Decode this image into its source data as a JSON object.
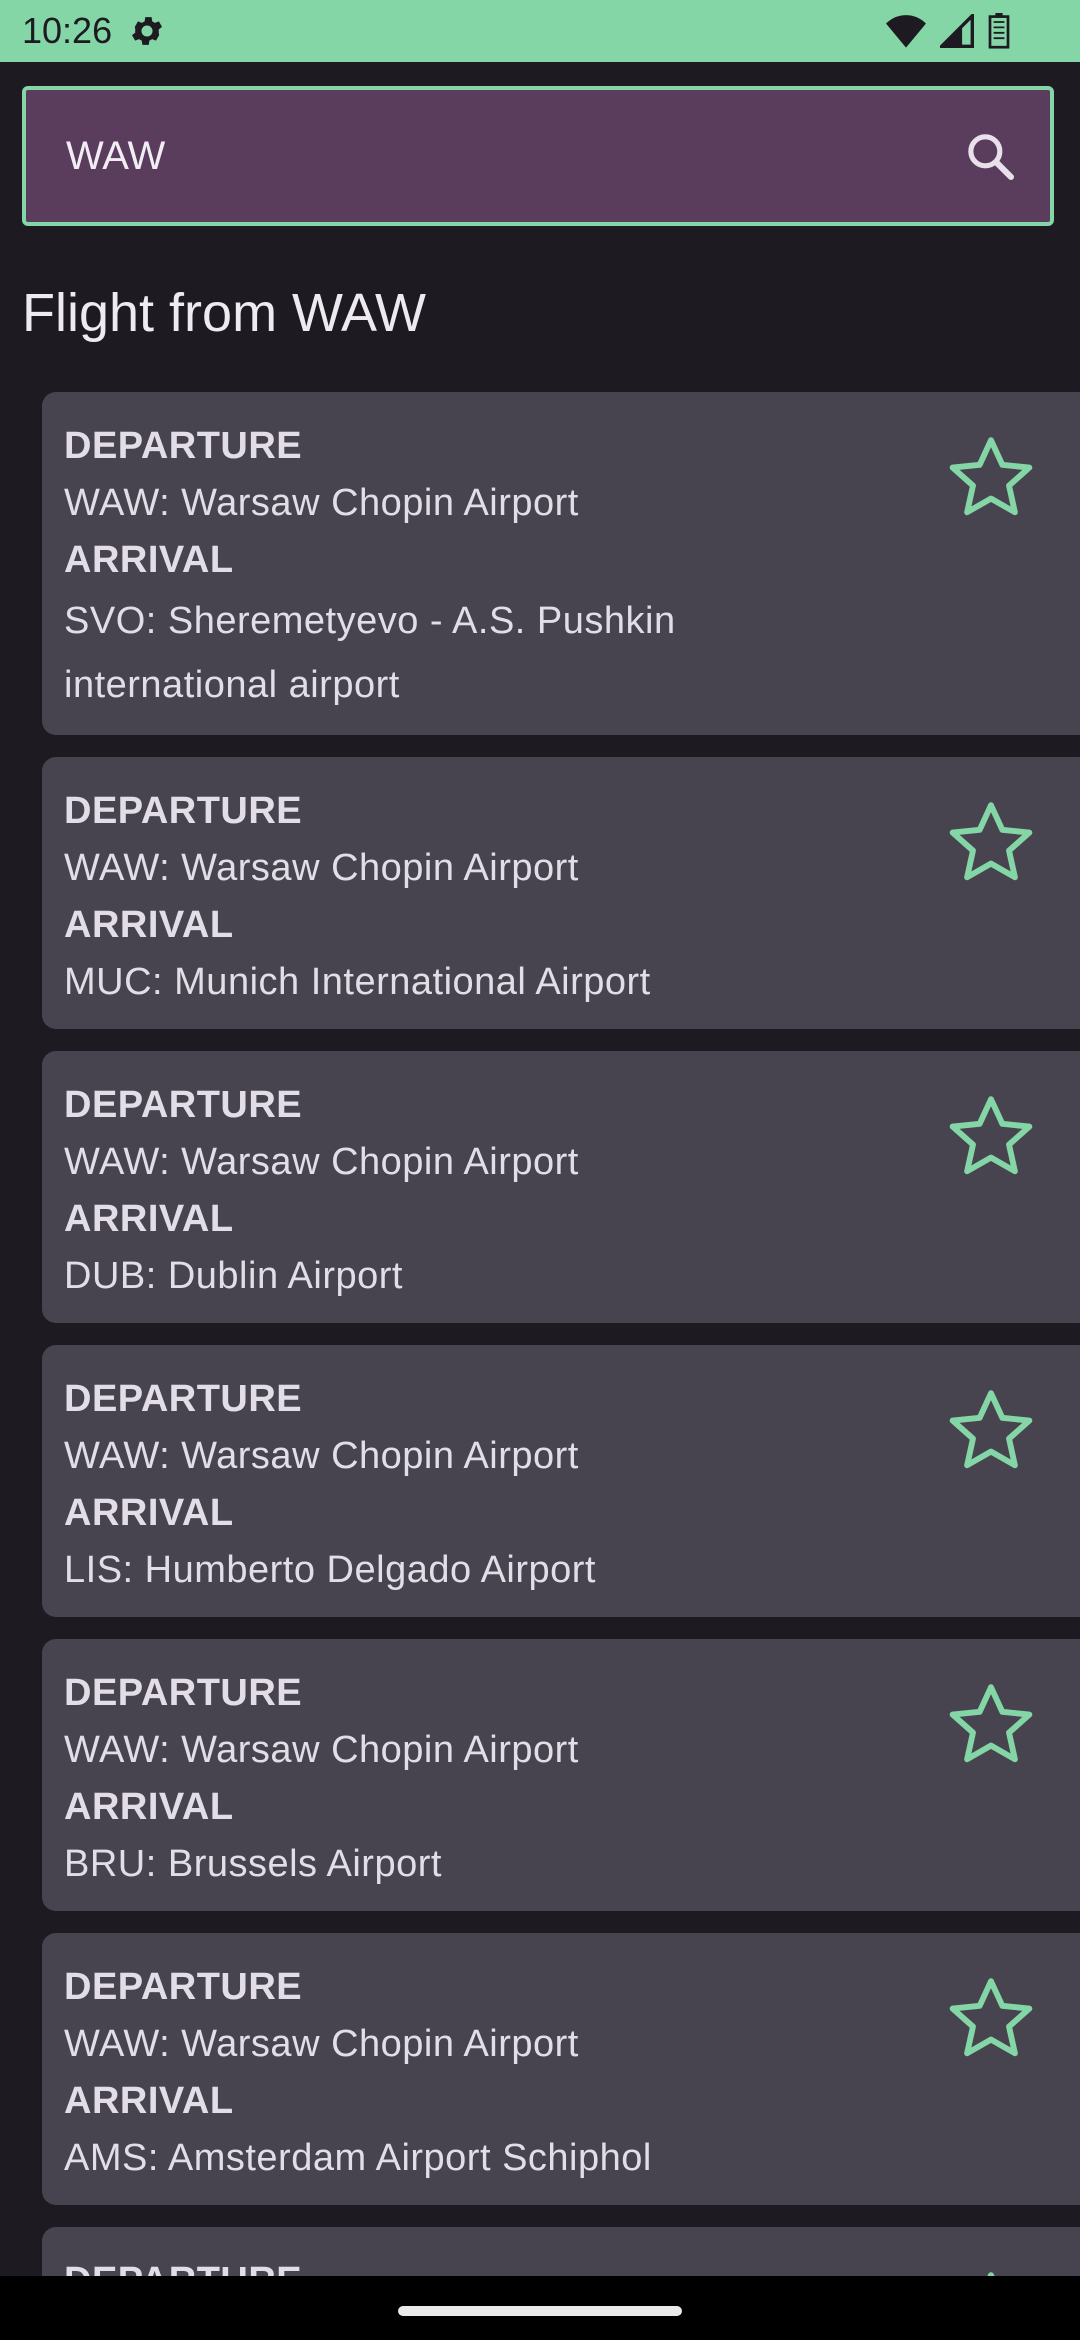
{
  "status_bar": {
    "time": "10:26",
    "icons": [
      "gear-icon",
      "wifi-icon",
      "signal-icon",
      "battery-icon"
    ]
  },
  "search": {
    "value": "WAW",
    "icon": "search-icon"
  },
  "section_title": "Flight from WAW",
  "colors": {
    "accent": "#84d6a6",
    "background": "#1d1b21",
    "card": "#47444f",
    "search_fill": "#5a3c5c"
  },
  "flights": [
    {
      "departure_label": "DEPARTURE",
      "departure": "WAW: Warsaw Chopin Airport",
      "arrival_label": "ARRIVAL",
      "arrival": "SVO: Sheremetyevo - A.S. Pushkin international airport",
      "favorite": false
    },
    {
      "departure_label": "DEPARTURE",
      "departure": "WAW: Warsaw Chopin Airport",
      "arrival_label": "ARRIVAL",
      "arrival": "MUC: Munich International Airport",
      "favorite": false
    },
    {
      "departure_label": "DEPARTURE",
      "departure": "WAW: Warsaw Chopin Airport",
      "arrival_label": "ARRIVAL",
      "arrival": "DUB: Dublin Airport",
      "favorite": false
    },
    {
      "departure_label": "DEPARTURE",
      "departure": "WAW: Warsaw Chopin Airport",
      "arrival_label": "ARRIVAL",
      "arrival": "LIS: Humberto Delgado Airport",
      "favorite": false
    },
    {
      "departure_label": "DEPARTURE",
      "departure": "WAW: Warsaw Chopin Airport",
      "arrival_label": "ARRIVAL",
      "arrival": "BRU: Brussels Airport",
      "favorite": false
    },
    {
      "departure_label": "DEPARTURE",
      "departure": "WAW: Warsaw Chopin Airport",
      "arrival_label": "ARRIVAL",
      "arrival": "AMS: Amsterdam Airport Schiphol",
      "favorite": false
    },
    {
      "departure_label": "DEPARTURE",
      "departure": "",
      "arrival_label": "",
      "arrival": "",
      "favorite": false
    }
  ]
}
